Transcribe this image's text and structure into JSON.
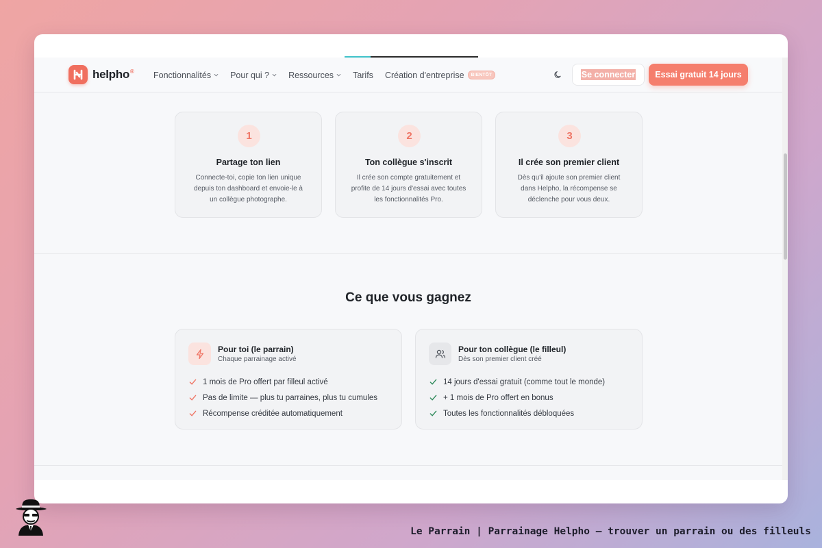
{
  "nav": {
    "brand": "helpho",
    "brand_mark": "®",
    "items": [
      {
        "label": "Fonctionnalités",
        "has_dropdown": true
      },
      {
        "label": "Pour qui ?",
        "has_dropdown": true
      },
      {
        "label": "Ressources",
        "has_dropdown": true
      },
      {
        "label": "Tarifs",
        "has_dropdown": false
      },
      {
        "label": "Création d'entreprise",
        "has_dropdown": false
      }
    ],
    "soon_badge": "BIENTÔT",
    "theme_icon": "moon-icon",
    "login_label": "Se connecter",
    "trial_label": "Essai gratuit 14 jours"
  },
  "steps": [
    {
      "number": "1",
      "title": "Partage ton lien",
      "lines": [
        "Connecte-toi, copie ton lien unique",
        "depuis ton dashboard et envoie-le à",
        "un collègue photographe."
      ]
    },
    {
      "number": "2",
      "title": "Ton collègue s'inscrit",
      "lines": [
        "Il crée son compte gratuitement et",
        "profite de 14 jours d'essai avec toutes",
        "les fonctionnalités Pro."
      ]
    },
    {
      "number": "3",
      "title": "Il crée son premier client",
      "lines": [
        "Dès qu'il ajoute son premier client",
        "dans Helpho, la récompense se",
        "déclenche pour vous deux."
      ]
    }
  ],
  "benefits": {
    "title": "Ce que vous gagnez",
    "referrer": {
      "icon": "lightning-icon",
      "title": "Pour toi (le parrain)",
      "subtitle": "Chaque parrainage activé",
      "items": [
        "1 mois de Pro offert par filleul activé",
        "Pas de limite — plus tu parraines, plus tu cumules",
        "Récompense créditée automatiquement"
      ]
    },
    "referee": {
      "icon": "users-icon",
      "title": "Pour ton collègue (le filleul)",
      "subtitle": "Dès son premier client créé",
      "items": [
        "14 jours d'essai gratuit (comme tout le monde)",
        "+ 1 mois de Pro offert en bonus",
        "Toutes les fonctionnalités débloquées"
      ]
    }
  },
  "colors": {
    "brand": "#f06f5f",
    "check_red": "#ef7565",
    "check_green": "#2f8a5b"
  },
  "caption": "Le Parrain | Parrainage Helpho — trouver un parrain ou des filleuls"
}
